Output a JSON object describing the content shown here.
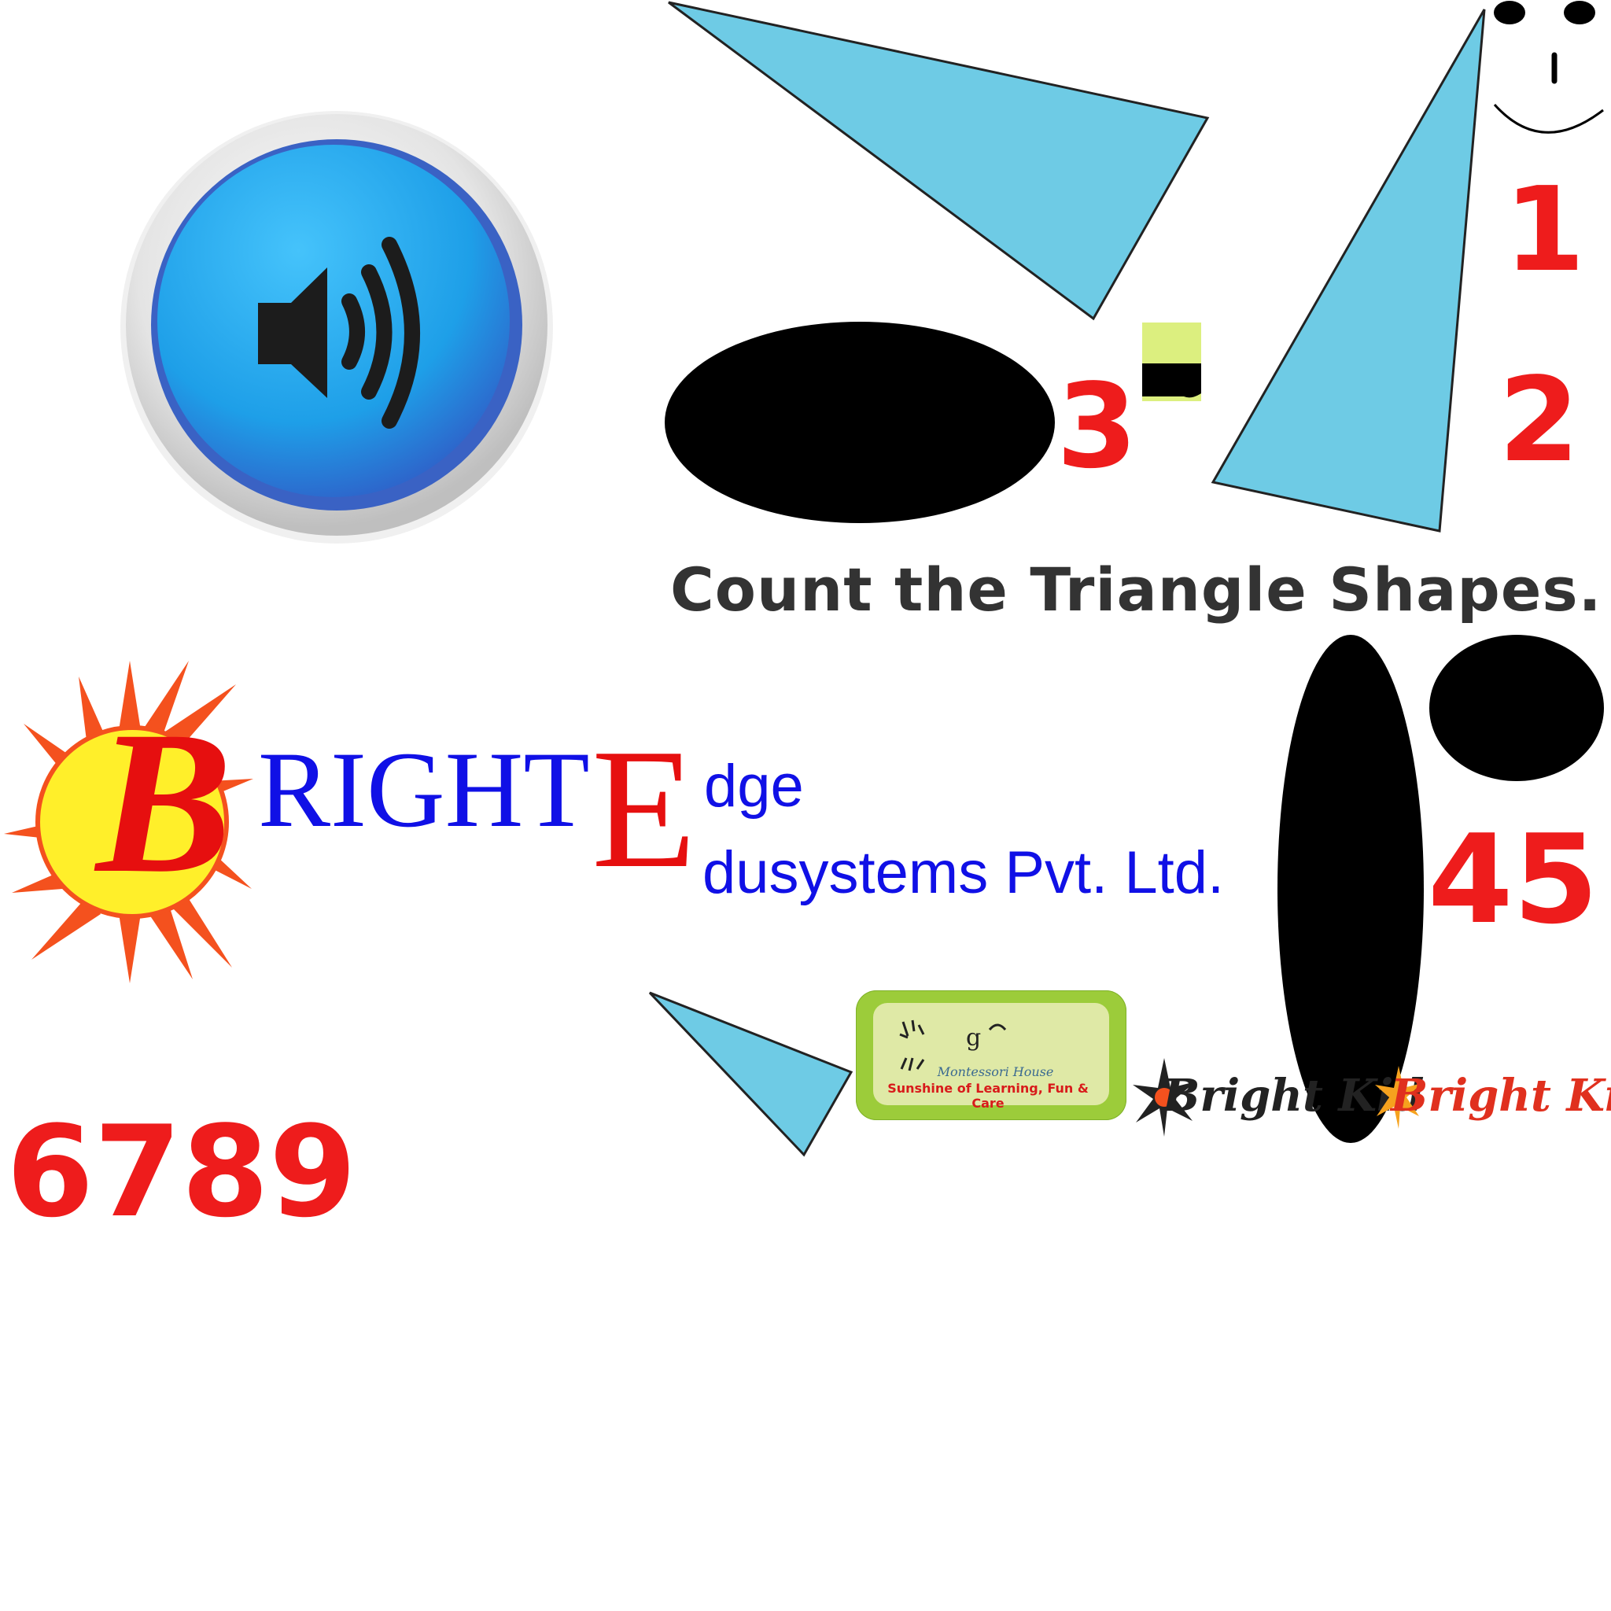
{
  "instruction": "Count the Triangle Shapes.",
  "numbers": {
    "n1": "1",
    "n2": "2",
    "n3": "3",
    "n45": "45",
    "n6789": "6789"
  },
  "brand": {
    "b_letter": "B",
    "right_text": "RIGHT",
    "e_letter": "E",
    "dge_text": "dge",
    "edusystems_text": "dusystems Pvt.  Ltd."
  },
  "montessori_logo": {
    "title": "Montessori House",
    "slogan": "Sunshine of Learning, Fun & Care"
  },
  "brightkid_logos": {
    "first": "Bright Kid",
    "second": "Bright Kid"
  },
  "colors": {
    "triangle_fill": "#6ecbe5",
    "numbers_red": "#ee1c1c",
    "brand_blue": "#1010e6",
    "brand_red": "#e60f0f",
    "sun_yellow": "#ffef2a",
    "sun_orange": "#f4511e",
    "sound_button_blue": "#27a6ec"
  },
  "icons": {
    "sound_button": "speaker-volume-icon",
    "face": "smiley-face-icon"
  }
}
